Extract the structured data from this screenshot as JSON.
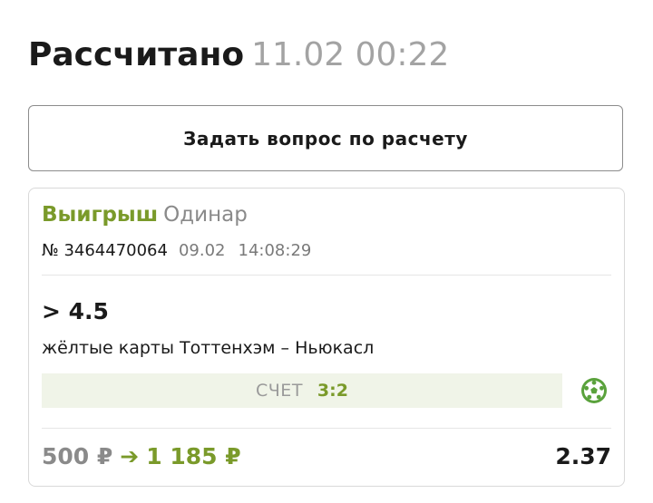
{
  "header": {
    "status": "Рассчитано",
    "settled_time": "11.02 00:22"
  },
  "ask_button": {
    "label": "Задать вопрос по расчету"
  },
  "bet": {
    "result": "Выигрыш",
    "kind": "Одинар",
    "ticket_number": "№ 3464470064",
    "date": "09.02",
    "time": "14:08:29",
    "outcome": "> 4.5",
    "event": "жёлтые карты Тоттенхэм – Ньюкасл",
    "score_label": "СЧЕТ",
    "score_value": "3:2",
    "sport_icon": "football-ball-icon",
    "stake": "500 ₽",
    "arrow": "➔",
    "payout": "1 185 ₽",
    "coefficient": "2.37"
  },
  "colors": {
    "win_green": "#7a9a2a",
    "score_bg": "#f0f4e8",
    "icon_green": "#5aa23c"
  }
}
